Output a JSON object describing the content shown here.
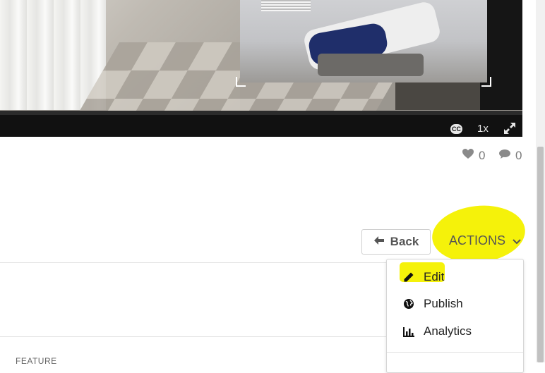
{
  "video": {
    "controls": {
      "captions_label": "CC",
      "speed_label": "1x"
    }
  },
  "engagement": {
    "likes": "0",
    "comments": "0"
  },
  "toolbar": {
    "back_label": "Back",
    "actions_label": "ACTIONS"
  },
  "actions_menu": {
    "items": [
      {
        "label": "Edit",
        "icon": "pencil-icon"
      },
      {
        "label": "Publish",
        "icon": "globe-icon"
      },
      {
        "label": "Analytics",
        "icon": "bar-chart-icon"
      }
    ]
  },
  "section": {
    "feature_label": "FEATURE"
  },
  "colors": {
    "highlight": "#f5f20a",
    "player_bar": "#111111"
  }
}
